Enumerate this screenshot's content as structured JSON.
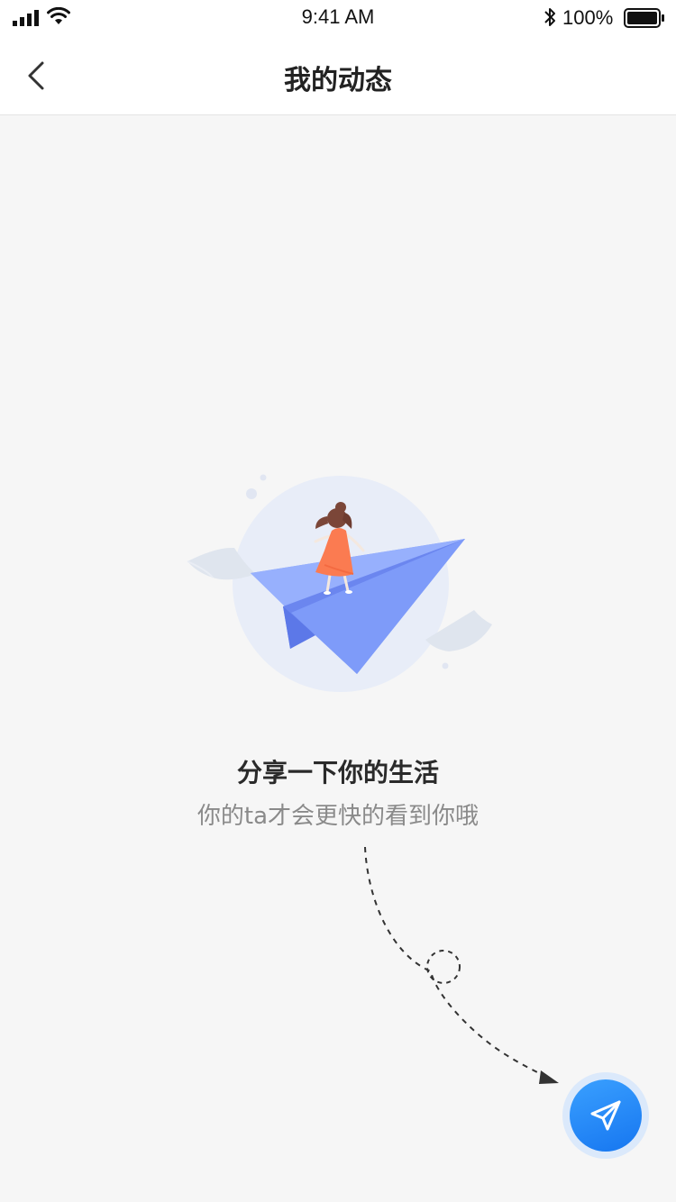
{
  "status_bar": {
    "time": "9:41 AM",
    "battery_text": "100%",
    "icons": [
      "signal-icon",
      "wifi-icon",
      "bluetooth-icon",
      "battery-icon"
    ]
  },
  "nav": {
    "title": "我的动态",
    "back_icon": "chevron-left-icon"
  },
  "empty_state": {
    "illustration": "paper-plane-girl-illustration",
    "title": "分享一下你的生活",
    "subtitle": "你的ta才会更快的看到你哦"
  },
  "fab": {
    "icon": "send-icon",
    "color": "#1676f0"
  },
  "colors": {
    "background": "#f6f6f6",
    "accent": "#2c8cf8"
  }
}
